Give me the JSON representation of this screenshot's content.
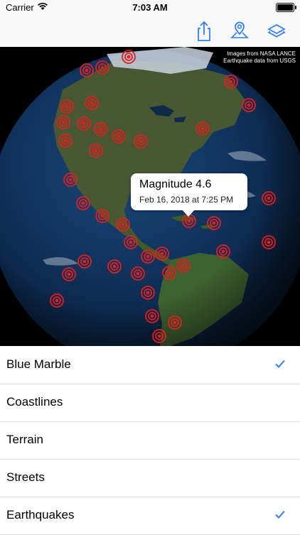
{
  "status_bar": {
    "carrier": "Carrier",
    "time": "7:03 AM"
  },
  "toolbar": {
    "buttons": [
      {
        "icon": "share-icon"
      },
      {
        "icon": "location-pin-icon"
      },
      {
        "icon": "layers-icon"
      }
    ]
  },
  "map": {
    "credits_line1": "Images from NASA LANCE",
    "credits_line2": "Earthquake data from USGS",
    "callout": {
      "title": "Magnitude 4.6",
      "subtitle": "Feb 16, 2018 at 7:25 PM"
    }
  },
  "layers": [
    {
      "label": "Blue Marble",
      "checked": true
    },
    {
      "label": "Coastlines",
      "checked": false
    },
    {
      "label": "Terrain",
      "checked": false
    },
    {
      "label": "Streets",
      "checked": false
    },
    {
      "label": "Earthquakes",
      "checked": true
    }
  ],
  "colors": {
    "accent": "#2f7ef6",
    "marker": "#e21e1e",
    "toolbar_bg": "#f8f8f8"
  }
}
